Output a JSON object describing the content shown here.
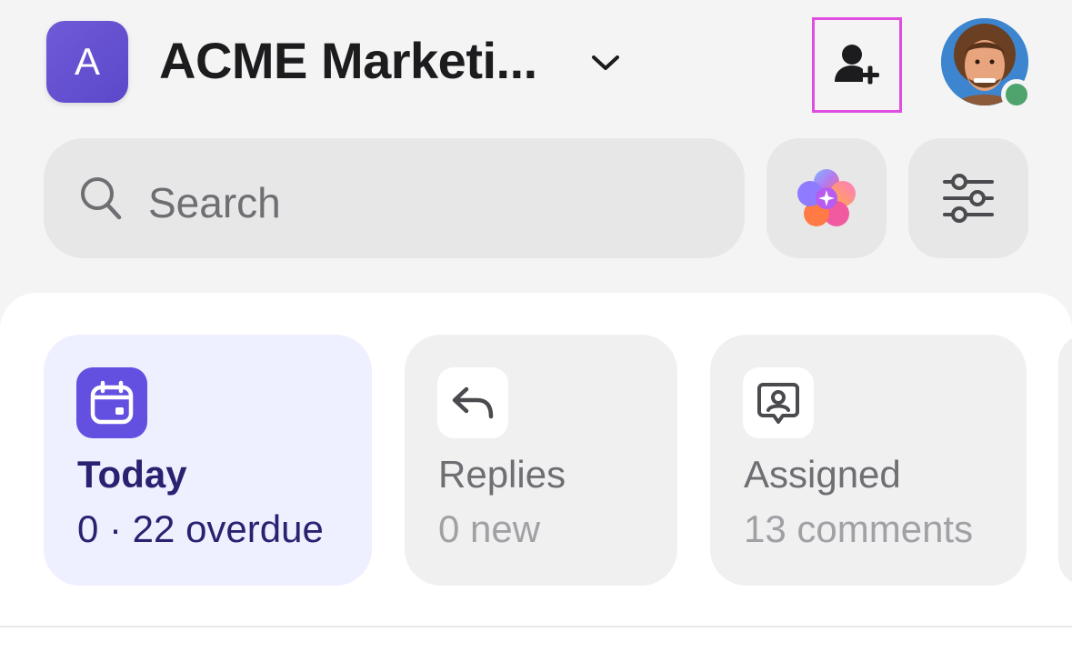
{
  "header": {
    "workspace_initial": "A",
    "workspace_name": "ACME Marketi...",
    "accent": "#5b48c9",
    "add_user_icon": "person-plus-icon",
    "avatar_status": "online"
  },
  "search": {
    "placeholder": "Search",
    "icon": "search-icon"
  },
  "actions": {
    "ai_icon": "ai-sparkle-icon",
    "filter_icon": "sliders-icon"
  },
  "cards": [
    {
      "title": "Today",
      "subtitle": "0 · 22 overdue",
      "icon": "calendar-icon",
      "active": true
    },
    {
      "title": "Replies",
      "subtitle": "0 new",
      "icon": "reply-icon",
      "active": false
    },
    {
      "title": "Assigned",
      "subtitle": "13 comments",
      "icon": "assigned-comment-icon",
      "active": false
    }
  ],
  "colors": {
    "background": "#f4f4f5",
    "active_card": "#eeefff",
    "active_text": "#2a2270",
    "online": "#4fa36d",
    "highlight": "#e04ee0"
  }
}
